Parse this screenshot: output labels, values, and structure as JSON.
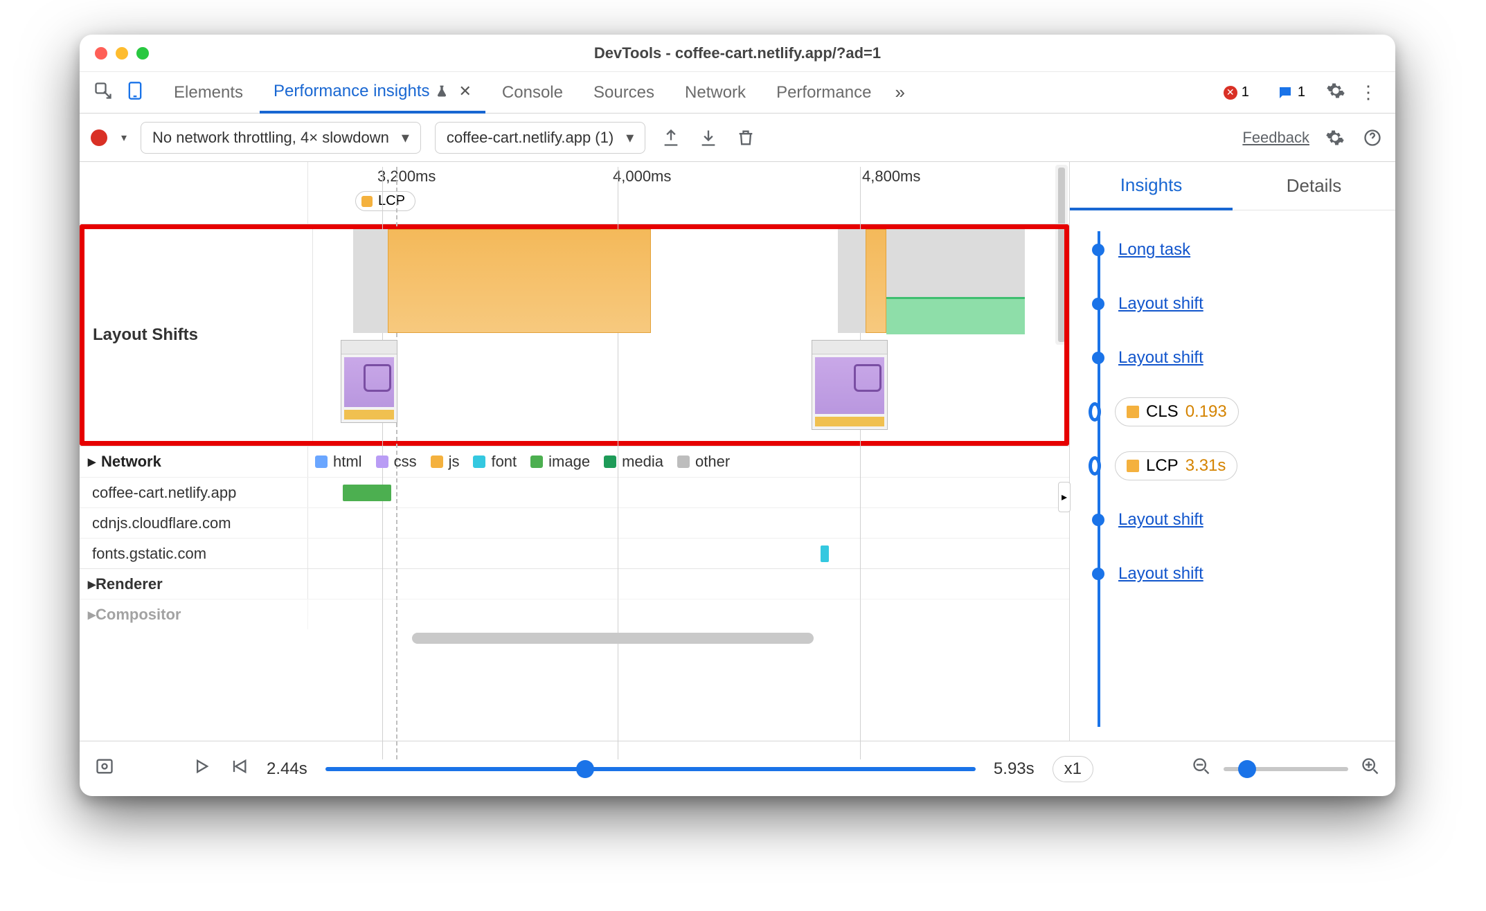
{
  "window": {
    "title": "DevTools - coffee-cart.netlify.app/?ad=1"
  },
  "tabs": {
    "items": [
      "Elements",
      "Performance insights",
      "Console",
      "Sources",
      "Network",
      "Performance"
    ],
    "activeIndex": 1,
    "errors": "1",
    "messages": "1"
  },
  "toolbar": {
    "throttling": "No network throttling, 4× slowdown",
    "recording": "coffee-cart.netlify.app (1)",
    "feedback": "Feedback"
  },
  "ruler": {
    "ticks": [
      "3,200ms",
      "4,000ms",
      "4,800ms"
    ],
    "lcp": "LCP"
  },
  "layoutShifts": {
    "label": "Layout Shifts"
  },
  "network": {
    "label": "Network",
    "legend": [
      "html",
      "css",
      "js",
      "font",
      "image",
      "media",
      "other"
    ],
    "legendColors": [
      "#6aa6ff",
      "#b99cf5",
      "#f4b13e",
      "#34c8e0",
      "#4caf50",
      "#1e9b58",
      "#bdbdbd"
    ],
    "rows": [
      "coffee-cart.netlify.app",
      "cdnjs.cloudflare.com",
      "fonts.gstatic.com"
    ]
  },
  "renderer": {
    "label": "Renderer"
  },
  "compositor": {
    "label": "Compositor"
  },
  "footer": {
    "start": "2.44s",
    "end": "5.93s",
    "speed": "x1"
  },
  "sidepanel": {
    "tabs": [
      "Insights",
      "Details"
    ],
    "events": [
      {
        "type": "link",
        "label": "Long task"
      },
      {
        "type": "link",
        "label": "Layout shift"
      },
      {
        "type": "link",
        "label": "Layout shift"
      },
      {
        "type": "metric",
        "name": "CLS",
        "value": "0.193",
        "color": "#f4b13e"
      },
      {
        "type": "metric",
        "name": "LCP",
        "value": "3.31s",
        "color": "#f4b13e"
      },
      {
        "type": "link",
        "label": "Layout shift"
      },
      {
        "type": "link",
        "label": "Layout shift"
      }
    ]
  }
}
